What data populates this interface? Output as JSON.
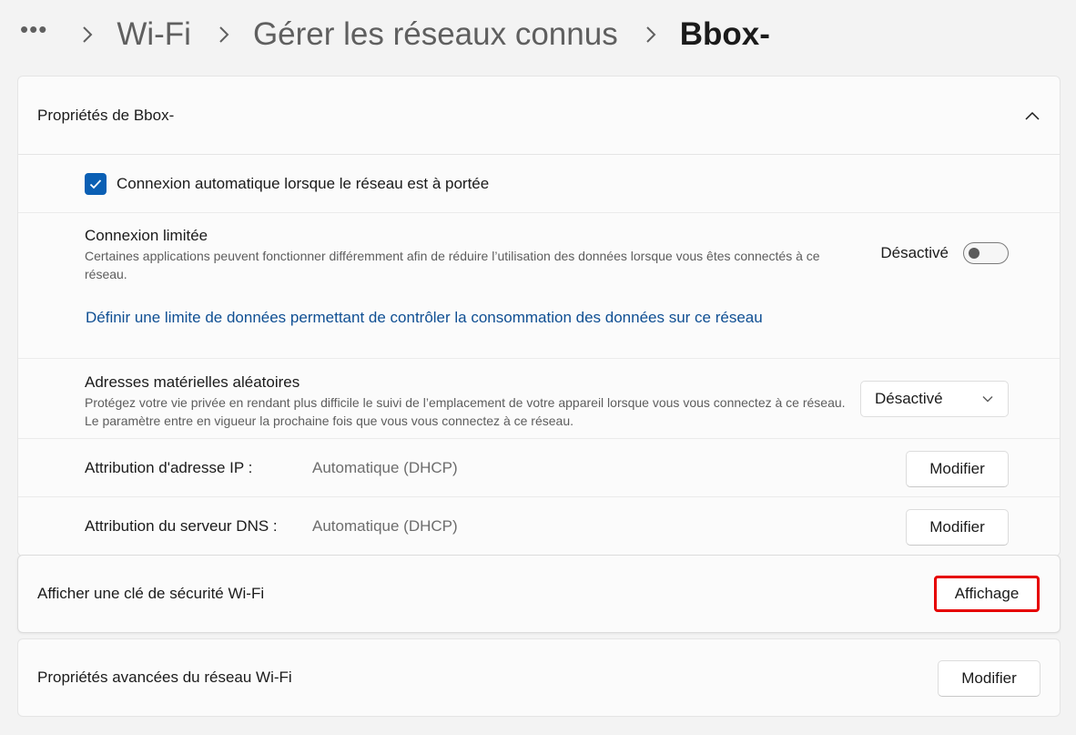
{
  "breadcrumb": {
    "more": "•••",
    "items": [
      "Wi-Fi",
      "Gérer les réseaux connus"
    ],
    "current": "Bbox-"
  },
  "properties": {
    "title": "Propriétés de Bbox-",
    "auto_connect": {
      "label": "Connexion automatique lorsque le réseau est à portée",
      "checked": true
    },
    "metered": {
      "title": "Connexion limitée",
      "description": "Certaines applications peuvent fonctionner différemment afin de réduire l’utilisation des données lorsque vous êtes connectés à ce réseau.",
      "state_label": "Désactivé",
      "enabled": false,
      "link": "Définir une limite de données permettant de contrôler la consommation des données sur ce réseau"
    },
    "random_mac": {
      "title": "Adresses matérielles aléatoires",
      "description": "Protégez votre vie privée en rendant plus difficile le suivi de l’emplacement de votre appareil lorsque vous vous connectez à ce réseau. Le paramètre entre en vigueur la prochaine fois que vous vous connectez à ce réseau.",
      "selected": "Désactivé"
    },
    "ip": {
      "label": "Attribution d'adresse IP :",
      "value": "Automatique (DHCP)",
      "button": "Modifier"
    },
    "dns": {
      "label": "Attribution du serveur DNS :",
      "value": "Automatique (DHCP)",
      "button": "Modifier"
    }
  },
  "security_key": {
    "label": "Afficher une clé de sécurité Wi-Fi",
    "button": "Affichage"
  },
  "advanced": {
    "label": "Propriétés avancées du réseau Wi-Fi",
    "button": "Modifier"
  },
  "colors": {
    "accent": "#0a5fb4",
    "link": "#0f4f93",
    "highlight": "#e60000",
    "background": "#f3f3f3"
  }
}
